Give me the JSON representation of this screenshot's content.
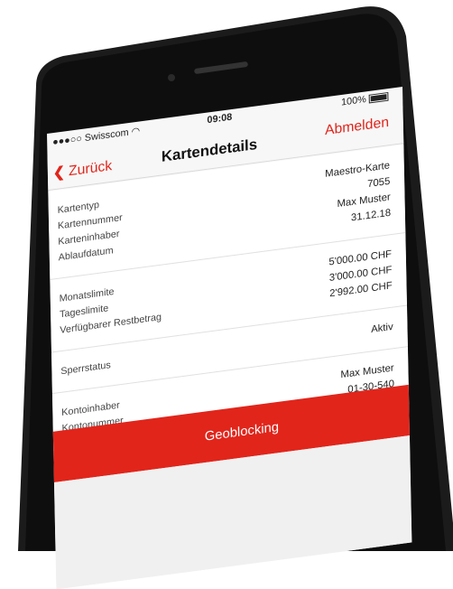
{
  "status": {
    "carrier": "●●●○○ Swisscom",
    "wifi_icon": "wifi-icon",
    "time": "09:08",
    "battery": "100%"
  },
  "nav": {
    "back_label": "Zurück",
    "title": "Kartendetails",
    "logout_label": "Abmelden"
  },
  "details": {
    "card_rows": [
      {
        "label": "Kartentyp",
        "value": "Maestro-Karte"
      },
      {
        "label": "Kartennummer",
        "value": "7055"
      },
      {
        "label": "Karteninhaber",
        "value": "Max Muster"
      },
      {
        "label": "Ablaufdatum",
        "value": "31.12.18"
      }
    ],
    "limit_rows": [
      {
        "label": "Monatslimite",
        "value": "5'000.00 CHF"
      },
      {
        "label": "Tageslimite",
        "value": "3'000.00 CHF"
      },
      {
        "label": "Verfügbarer Restbetrag",
        "value": "2'992.00 CHF"
      }
    ],
    "lock_rows": [
      {
        "label": "Sperrstatus",
        "value": "Aktiv"
      }
    ],
    "account_rows": [
      {
        "label": "Kontoinhaber",
        "value": "Max Muster"
      },
      {
        "label": "Kontonummer",
        "value": "01-30-540"
      }
    ]
  },
  "geoblocking_label": "Geoblocking",
  "colors": {
    "accent": "#e1251b",
    "phone_frame": "#1a1a1a"
  }
}
